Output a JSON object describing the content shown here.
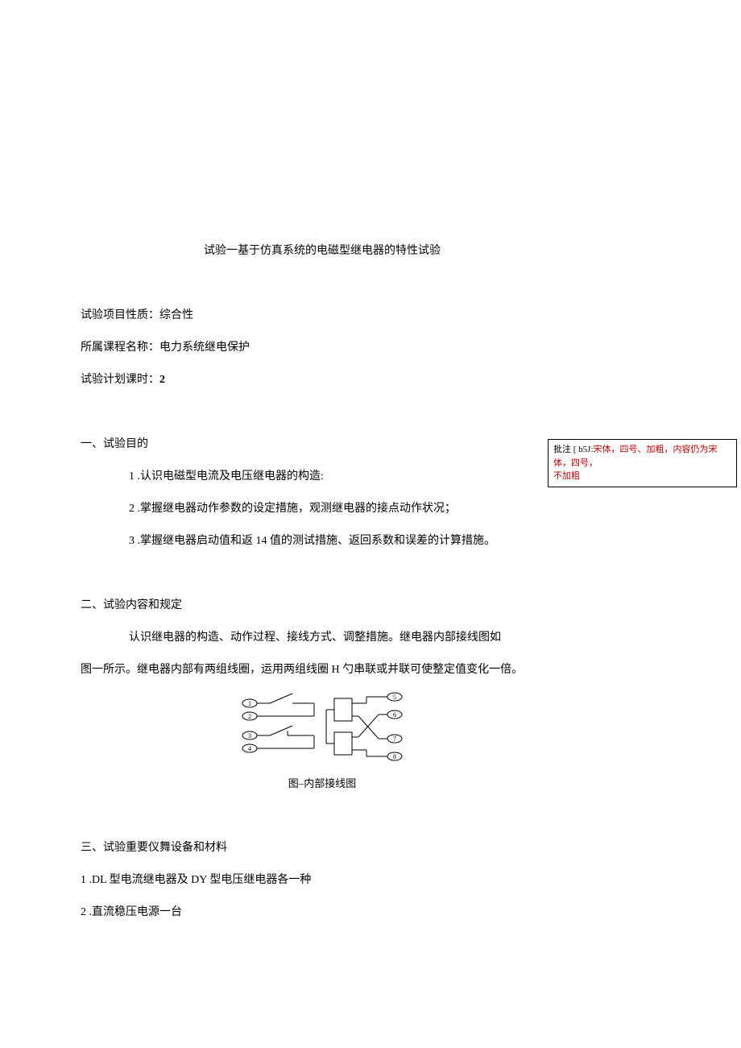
{
  "title": "试验一基于仿真系统的电磁型继电器的特性试验",
  "meta": {
    "nature_label": "试验项目性质：",
    "nature_value": "综合性",
    "course_label": "所属课程名称：",
    "course_value": "电力系统继电保护",
    "hours_label": "试验计划课时：",
    "hours_value": "2"
  },
  "section1": {
    "heading": "一、试验目的",
    "items": [
      "1 .认识电磁型电流及电压继电器的构造:",
      "2 .掌握继电器动作参数的设定措施，观测继电器的接点动作状况；",
      "3 .掌握继电器启动值和返 14 值的测试措施、返回系数和误差的计算措施。"
    ]
  },
  "section2": {
    "heading": "二、试验内容和规定",
    "para1": "认识继电器的构造、动作过程、接线方式、调整措施。继电器内部接线图如",
    "para2": "图一所示。继电器内部有两组线圈，运用两组线圈 H 勺串联或并联可使整定值变化一倍。",
    "caption": "图–内部接线图"
  },
  "section3": {
    "heading": "三、试验重要仪舞设备和材料",
    "items": [
      "1 .DL 型电流继电器及 DY 型电压继电器各一种",
      "2 .直流稳压电源一台"
    ]
  },
  "annotation": {
    "prefix": "批注 [ b5J:",
    "content1": "宋体，四号、加粗，内容仍为宋体，四号，",
    "content2": "不加粗"
  },
  "diagram": {
    "terminals": [
      "1",
      "2",
      "3",
      "4",
      "5",
      "6",
      "7",
      "8"
    ]
  }
}
